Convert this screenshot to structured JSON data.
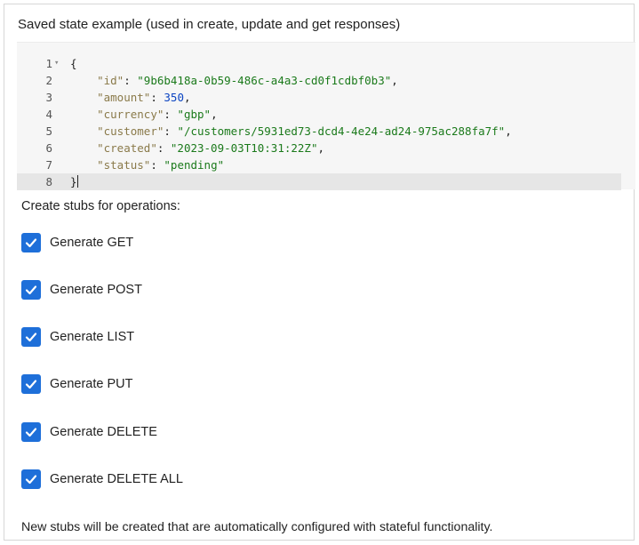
{
  "heading": "Saved state example (used in create, update and get responses)",
  "code": {
    "lines": [
      {
        "n": "1",
        "fold": true
      },
      {
        "n": "2"
      },
      {
        "n": "3"
      },
      {
        "n": "4"
      },
      {
        "n": "5"
      },
      {
        "n": "6"
      },
      {
        "n": "7"
      },
      {
        "n": "8"
      }
    ],
    "open_brace": "{",
    "close_brace": "}",
    "fields": [
      {
        "key": "\"id\"",
        "value": "\"9b6b418a-0b59-486c-a4a3-cd0f1cdbf0b3\"",
        "kind": "str",
        "comma": ","
      },
      {
        "key": "\"amount\"",
        "value": "350",
        "kind": "num",
        "comma": ","
      },
      {
        "key": "\"currency\"",
        "value": "\"gbp\"",
        "kind": "str",
        "comma": ","
      },
      {
        "key": "\"customer\"",
        "value": "\"/customers/5931ed73-dcd4-4e24-ad24-975ac288fa7f\"",
        "kind": "str",
        "comma": ","
      },
      {
        "key": "\"created\"",
        "value": "\"2023-09-03T10:31:22Z\"",
        "kind": "str",
        "comma": ","
      },
      {
        "key": "\"status\"",
        "value": "\"pending\"",
        "kind": "str",
        "comma": ""
      }
    ]
  },
  "operations": {
    "label": "Create stubs for operations:",
    "items": [
      {
        "label": "Generate GET",
        "checked": true
      },
      {
        "label": "Generate POST",
        "checked": true
      },
      {
        "label": "Generate LIST",
        "checked": true
      },
      {
        "label": "Generate PUT",
        "checked": true
      },
      {
        "label": "Generate DELETE",
        "checked": true
      },
      {
        "label": "Generate DELETE ALL",
        "checked": true
      }
    ]
  },
  "note": "New stubs will be created that are automatically configured with stateful functionality.",
  "colors": {
    "checkbox": "#1e6fd9",
    "string": "#1b7a1b",
    "number": "#0b44c2",
    "key": "#8a7a4a"
  }
}
